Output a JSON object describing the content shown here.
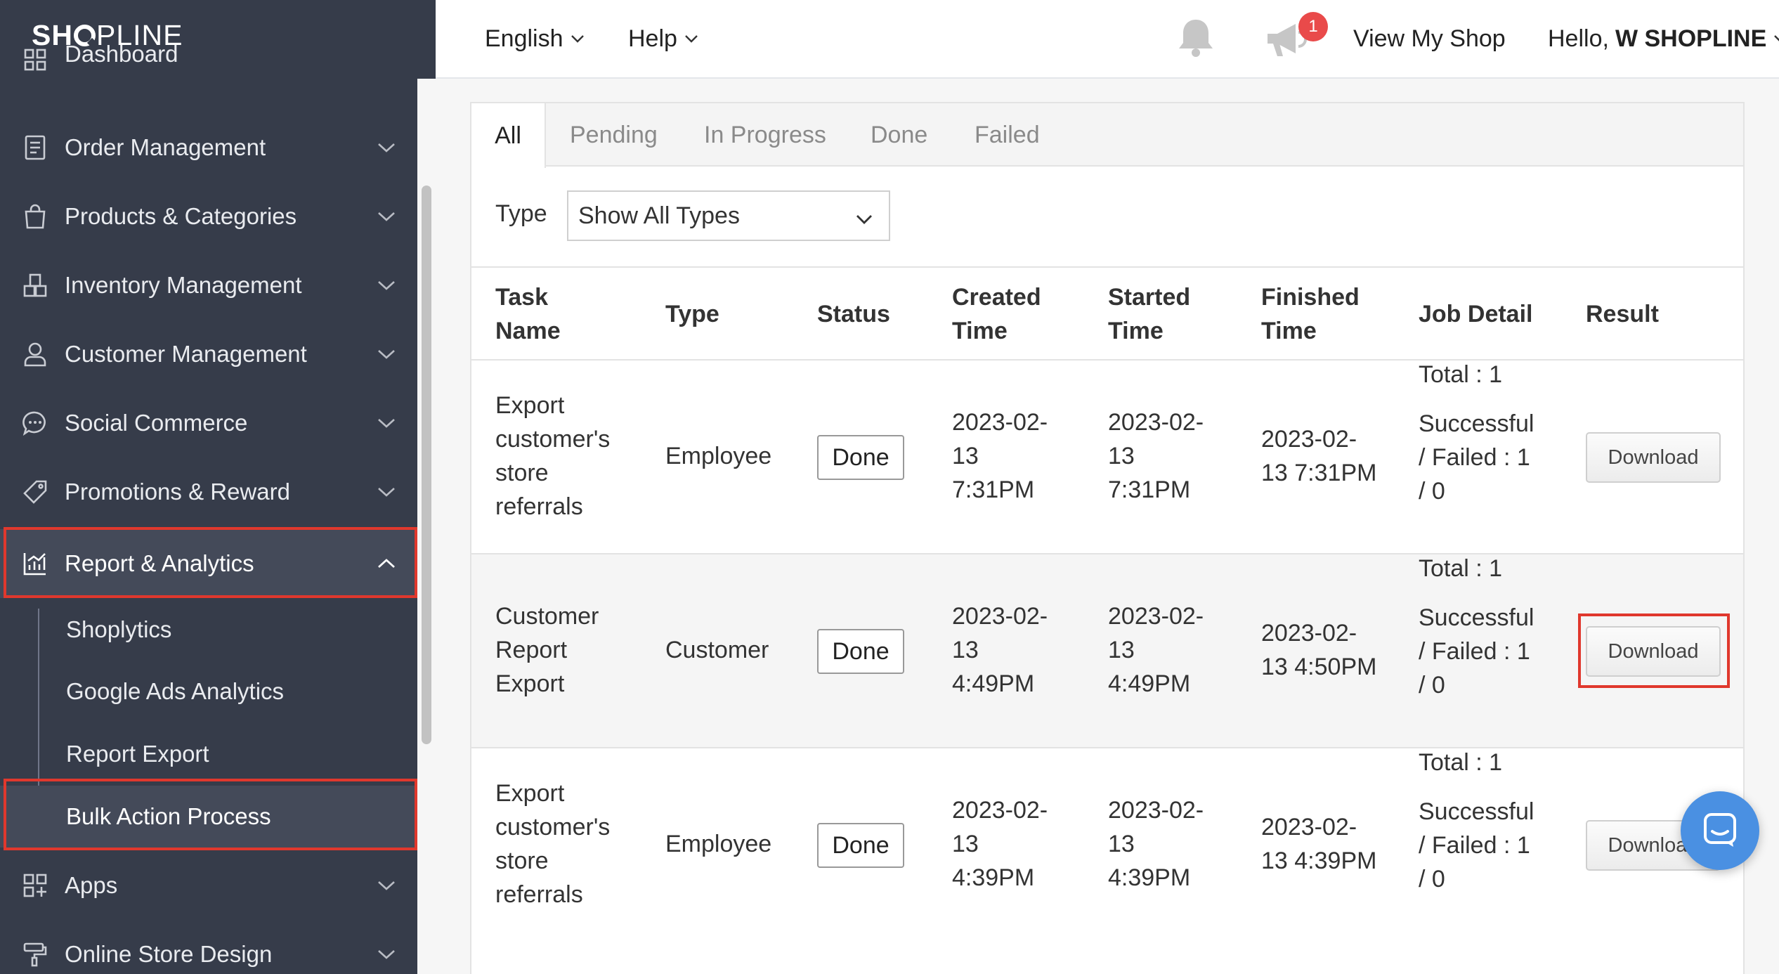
{
  "brand": {
    "logo_a": "SH",
    "logo_b": "PLINE"
  },
  "sidebar": {
    "items": [
      {
        "label": "Dashboard",
        "icon": "dashboard-icon"
      },
      {
        "label": "Order Management",
        "icon": "order-icon"
      },
      {
        "label": "Products & Categories",
        "icon": "shopping-bag-icon"
      },
      {
        "label": "Inventory Management",
        "icon": "inventory-icon"
      },
      {
        "label": "Customer Management",
        "icon": "user-icon"
      },
      {
        "label": "Social Commerce",
        "icon": "chat-icon"
      },
      {
        "label": "Promotions & Reward",
        "icon": "tag-icon"
      },
      {
        "label": "Report & Analytics",
        "icon": "analytics-icon"
      },
      {
        "label": "Apps",
        "icon": "apps-icon"
      },
      {
        "label": "Online Store Design",
        "icon": "paint-roller-icon"
      }
    ],
    "subitems": [
      {
        "label": "Shoplytics"
      },
      {
        "label": "Google Ads Analytics"
      },
      {
        "label": "Report Export"
      },
      {
        "label": "Bulk Action Process"
      }
    ]
  },
  "topbar": {
    "language": "English",
    "help": "Help",
    "notification_count": "1",
    "view_shop": "View My Shop",
    "hello_prefix": "Hello,",
    "user_name": "W SHOPLINE"
  },
  "tabs": [
    {
      "label": "All"
    },
    {
      "label": "Pending"
    },
    {
      "label": "In Progress"
    },
    {
      "label": "Done"
    },
    {
      "label": "Failed"
    }
  ],
  "filter": {
    "label": "Type",
    "value": "Show All Types"
  },
  "table": {
    "headers": {
      "task_name_1": "Task",
      "task_name_2": "Name",
      "type": "Type",
      "status": "Status",
      "created_1": "Created",
      "created_2": "Time",
      "started_1": "Started",
      "started_2": "Time",
      "finished_1": "Finished",
      "finished_2": "Time",
      "job_detail": "Job Detail",
      "result": "Result"
    },
    "rows": [
      {
        "task_lines": [
          "Export",
          "customer's",
          "store",
          "referrals"
        ],
        "type": "Employee",
        "status": "Done",
        "created_lines": [
          "2023-02-",
          "13",
          "7:31PM"
        ],
        "started_lines": [
          "2023-02-",
          "13",
          "7:31PM"
        ],
        "finished_lines": [
          "2023-02-",
          "13 7:31PM"
        ],
        "total": "Total : 1",
        "detail_lines": [
          "Successful",
          "/ Failed : 1",
          "/ 0"
        ],
        "result": "Download"
      },
      {
        "task_lines": [
          "Customer",
          "Report",
          "Export"
        ],
        "type": "Customer",
        "status": "Done",
        "created_lines": [
          "2023-02-",
          "13",
          "4:49PM"
        ],
        "started_lines": [
          "2023-02-",
          "13",
          "4:49PM"
        ],
        "finished_lines": [
          "2023-02-",
          "13 4:50PM"
        ],
        "total": "Total : 1",
        "detail_lines": [
          "Successful",
          "/ Failed : 1",
          "/ 0"
        ],
        "result": "Download"
      },
      {
        "task_lines": [
          "Export",
          "customer's",
          "store",
          "referrals"
        ],
        "type": "Employee",
        "status": "Done",
        "created_lines": [
          "2023-02-",
          "13",
          "4:39PM"
        ],
        "started_lines": [
          "2023-02-",
          "13",
          "4:39PM"
        ],
        "finished_lines": [
          "2023-02-",
          "13 4:39PM"
        ],
        "total": "Total : 1",
        "detail_lines": [
          "Successful",
          "/ Failed : 1",
          "/ 0"
        ],
        "result": "Download"
      }
    ]
  },
  "colors": {
    "sidebar_bg": "#363c4a",
    "highlight": "#e0382d",
    "chat": "#4a90e2",
    "badge": "#e94a4a"
  }
}
